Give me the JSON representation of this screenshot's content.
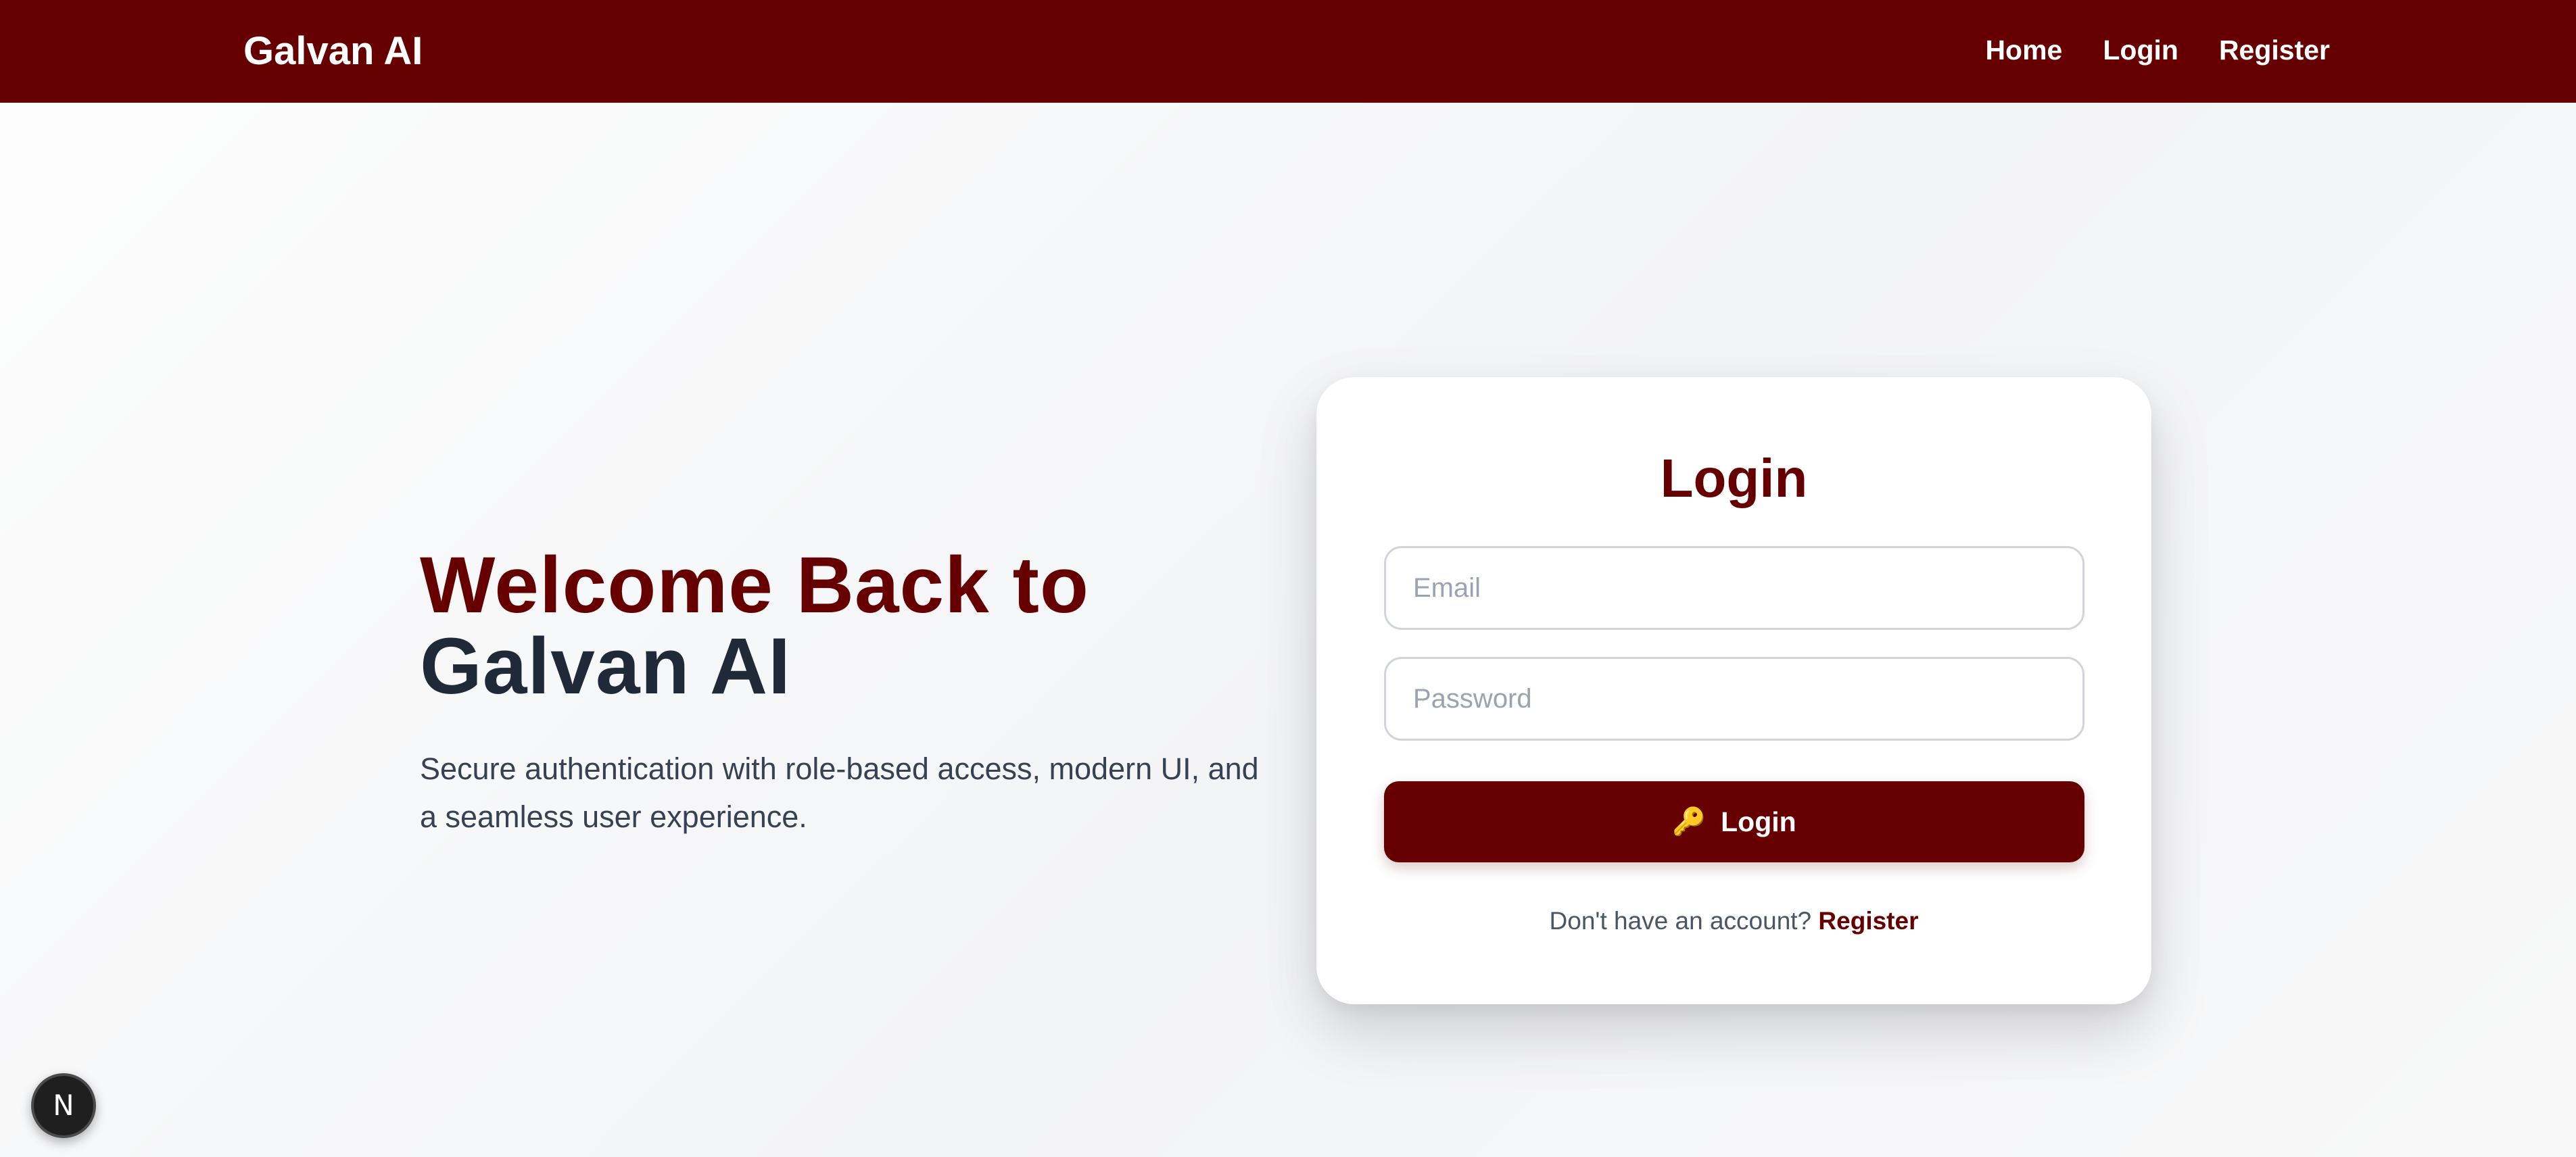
{
  "navbar": {
    "brand": "Galvan AI",
    "links": [
      "Home",
      "Login",
      "Register"
    ]
  },
  "hero": {
    "title_line1": "Welcome Back to",
    "title_line2": "Galvan AI",
    "subtitle": "Secure authentication with role-based access, modern UI, and a seamless user experience."
  },
  "login_card": {
    "title": "Login",
    "email_placeholder": "Email",
    "password_placeholder": "Password",
    "button_icon": "key-icon",
    "button_label": "Login",
    "no_account_text": "Don't have an account?",
    "register_link": "Register"
  },
  "dev_badge": {
    "letter": "N",
    "icon": "nextjs-icon"
  },
  "colors": {
    "brand": "#660000",
    "heading_dark": "#1f2937",
    "background": "#f3f4f6"
  }
}
